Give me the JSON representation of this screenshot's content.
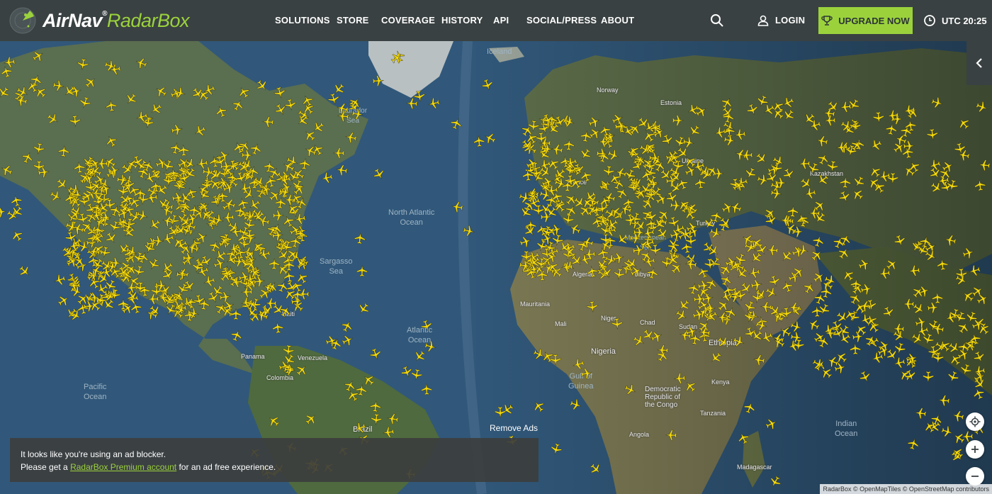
{
  "brand": {
    "name_part1": "AirNav",
    "name_part2": "RadarBox",
    "reg": "®"
  },
  "nav": {
    "items": [
      "SOLUTIONS",
      "STORE",
      "COVERAGE",
      "HISTORY",
      "API",
      "SOCIAL/PRESS",
      "ABOUT"
    ],
    "login_label": "LOGIN",
    "upgrade_label": "UPGRADE NOW",
    "time_label": "UTC 20:25"
  },
  "map": {
    "labels": {
      "iceland": "Iceland",
      "north_atlantic": "North Atlantic\nOcean",
      "sargasso": "Sargasso\nSea",
      "atlantic": "Atlantic\nOcean",
      "pacific": "Pacific\nOcean",
      "indian": "Indian\nOcean",
      "gulf_guinea": "Gulf of\nGuinea",
      "mediterranean": "Mediterranean\nSea",
      "labrador": "Labrador\nSea"
    },
    "countries": {
      "algeria": "Algeria",
      "libya": "Libya",
      "mali": "Mali",
      "niger": "Niger",
      "chad": "Chad",
      "sudan": "Sudan",
      "nigeria": "Nigeria",
      "ethiopia": "Ethiopia",
      "kenya": "Kenya",
      "tanzania": "Tanzania",
      "angola": "Angola",
      "drc": "Democratic\nRepublic of\nthe Congo",
      "brazil": "Brazil",
      "venezuela": "Venezuela",
      "mauritania": "Mauritania",
      "kazakhstan": "Kazakhstan",
      "ukraine": "Ukraine",
      "turkey": "Turkey",
      "madagascar": "Madagascar",
      "panama": "Panama",
      "haiti": "Haiti",
      "colombia": "Colombia",
      "france": "France",
      "norway": "Norway",
      "estonia": "Estonia"
    },
    "remove_ads": "Remove Ads",
    "attribution": "RadarBox © OpenMapTiles © OpenStreetMap contributors"
  },
  "adblock": {
    "line1": "It looks like you're using an ad blocker.",
    "line2_pre": "Please get a ",
    "line2_link": "RadarBox Premium account",
    "line2_post": " for an ad free experience."
  },
  "colors": {
    "accent": "#9bd23c",
    "plane": "#f5d90a",
    "navbar": "#3a4142"
  }
}
